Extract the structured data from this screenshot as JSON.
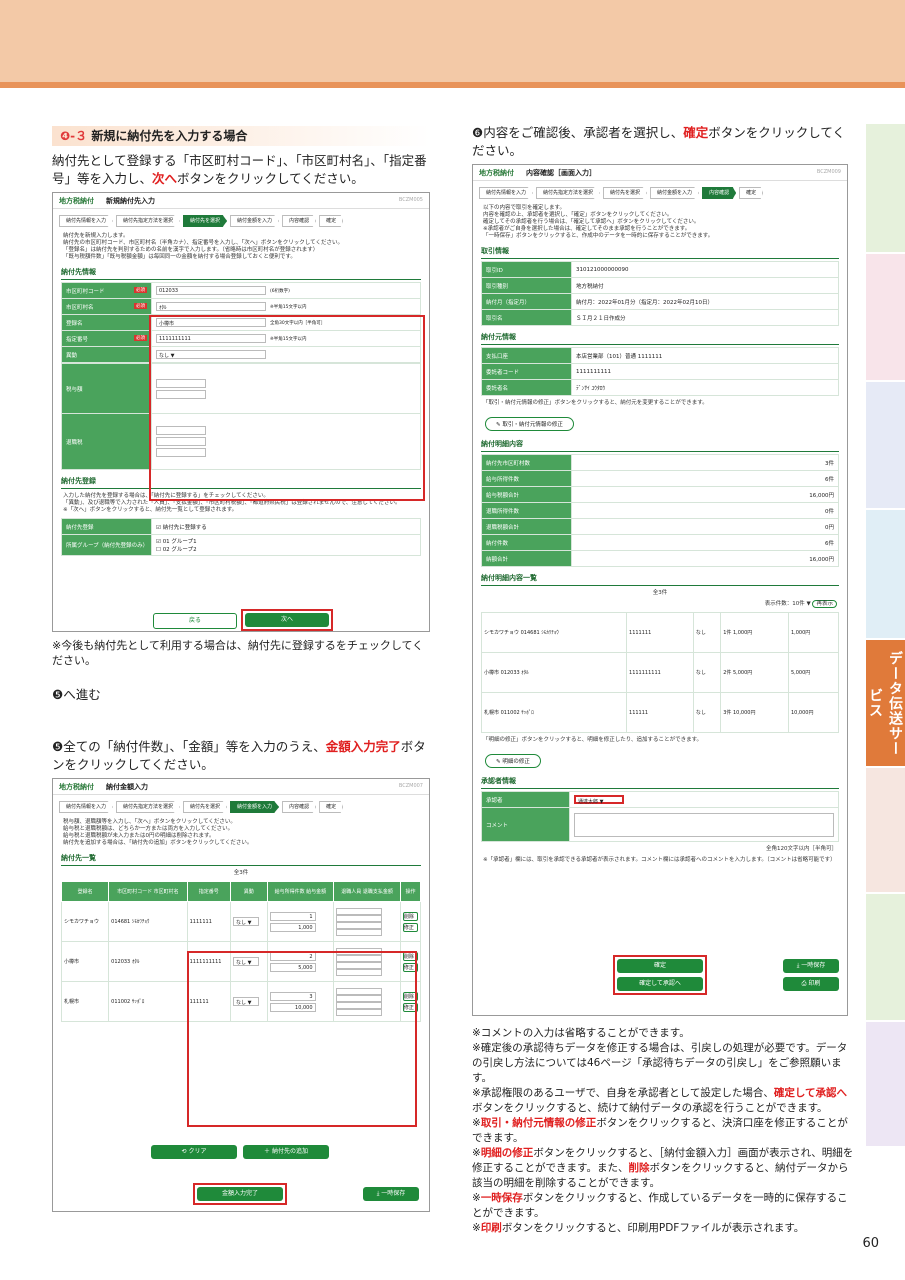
{
  "section4": {
    "num": "❹-３",
    "title": "新規に納付先を入力する場合",
    "para_a": "納付先として登録する「市区町村コード」、「市区町村名」、「指定番号」等を入力し、",
    "para_next": "次へ",
    "para_b": "ボタンをクリックしてください。",
    "footnote": "※今後も納付先として利用する場合は、納付先に登録するをチェックしてください。"
  },
  "goto5": "❺へ進む",
  "section5": {
    "text_a": "❺全ての「納付件数」、「金額」等を入力のうえ、",
    "text_red": "金額入力完了",
    "text_b": "ボタンをクリックしてください。"
  },
  "section6": {
    "text_a": "❻内容をご確認後、承認者を選択し、",
    "text_red": "確定",
    "text_b": "ボタンをクリックしてください。"
  },
  "shot1": {
    "app": "地方税納付",
    "title": "新規納付先入力",
    "code": "BCZM005",
    "steps": [
      "納付先情報を入力",
      "納付先指定方法を選択",
      "納付先を選択",
      "納付金額を入力",
      "内容確認",
      "確定"
    ],
    "active_step": 2,
    "intro": [
      "納付先を新規入力します。",
      "納付先の市区町村コード、市区町村名（半角カナ）、指定番号を入力し、「次へ」ボタンをクリックしてください。",
      "「登録名」は納付先を判別するための名前を漢字で入力します。（省略時は市区町村名が登録されます）",
      "「既与税額件数」「既与税額金額」は毎回同一の金額を納付する場合登録しておくと便利です。"
    ],
    "sec_title": "納付先情報",
    "rows": [
      {
        "label": "市区町村コード",
        "value": "012033",
        "hint": "(6桁数字)",
        "req": "必須"
      },
      {
        "label": "市区町村名",
        "value": "ｵﾀﾙ",
        "hint": "※半角15文字以内",
        "req": "必須"
      },
      {
        "label": "登録名",
        "value": "小樽市",
        "hint": "全角30文字以内［半角可］",
        "req": ""
      },
      {
        "label": "指定番号",
        "value": "1111111111",
        "hint": "※半角15文字以内",
        "req": "必須"
      },
      {
        "label": "異動",
        "value": "なし ▼",
        "hint": "",
        "req": ""
      }
    ],
    "reg_title": "納付先登録",
    "reg_note": [
      "入力した納付先を登録する場合は、「納付先に登録する」をチェックしてください。",
      "「異動」、及び退職等で入力された「人員」、「支払金額」、「市区町村税額」、「都道府県民税」は登録されませんので、注意してください。",
      "※「次へ」ボタンをクリックすると、納付先一覧として登録されます。"
    ],
    "reg_label": "納付先登録",
    "reg_check": "納付先に登録する",
    "group_label": "所属グループ（納付先登録のみ）",
    "groups": [
      "01 グループ1",
      "02 グループ2"
    ],
    "back": "戻る",
    "next": "次へ"
  },
  "shot2": {
    "app": "地方税納付",
    "title": "納付金額入力",
    "code": "BCZM007",
    "steps": [
      "納付先情報を入力",
      "納付先指定方法を選択",
      "納付先を選択",
      "納付金額を入力",
      "内容確認",
      "確定"
    ],
    "active_step": 3,
    "intro": [
      "税与額、退職額等を入力し、「次へ」ボタンをクリックしてください。",
      "給与税と退職税額は、どちらか一方または両方を入力してください。",
      "給与税と退職税額が未入力または0円の明細は削除されます。",
      "納付先を追加する場合は、「納付先の追加」ボタンをクリックしてください。"
    ],
    "sec_title": "納付先一覧",
    "count": "全3件",
    "cols": [
      "登録名",
      "市区町村コード 市区町村名",
      "指定番号",
      "異動",
      "給与所得件数 給与金額",
      "退職人員 退職支払金額",
      "操作"
    ],
    "rows": [
      {
        "name": "シモカワチョウ",
        "code": "014681 ｼﾓｶﾜﾁｮｳ",
        "num": "1111111",
        "move": "なし ▼",
        "cnt": "1",
        "amt": "1,000"
      },
      {
        "name": "小樽市",
        "code": "012033 ｵﾀﾙ",
        "num": "1111111111",
        "move": "なし ▼",
        "cnt": "2",
        "amt": "5,000"
      },
      {
        "name": "札幌市",
        "code": "011002 ｻｯﾎﾟﾛ",
        "num": "111111",
        "move": "なし ▼",
        "cnt": "3",
        "amt": "10,000"
      }
    ],
    "clear": "クリア",
    "add": "納付先の追加",
    "done": "金額入力完了",
    "save": "一時保存",
    "del": "削除",
    "edit": "修正"
  },
  "shot3": {
    "app": "地方税納付",
    "title": "内容確認［画面入力］",
    "code": "BCZM009",
    "steps": [
      "納付先情報を入力",
      "納付先指定方法を選択",
      "納付先を選択",
      "納付金額を入力",
      "内容確認",
      "確定"
    ],
    "active_step": 4,
    "intro": [
      "以下の内容で取引を確定します。",
      "内容を確認の上、承認者を選択し、「確定」ボタンをクリックしてください。",
      "確定してその承認者を行う場合は、「確定して承認へ」ボタンをクリックしてください。",
      "※承認者がご自身を選択した場合は、確定してそのまま承認を行うことができます。",
      "「一時保存」ボタンをクリックすると、作成中のデータを一時的に保存することができます。"
    ],
    "tx_title": "取引情報",
    "tx": [
      [
        "取引ID",
        "310121000000090"
      ],
      [
        "取引種別",
        "地方税納付"
      ],
      [
        "納付月（指定月）",
        "納付月：2022年01月分（指定月：2022年02月10日）"
      ],
      [
        "取引名",
        "ＳＩ月２１日作成分"
      ]
    ],
    "acc_title": "納付元情報",
    "acc": [
      [
        "支払口座",
        "本店営業部（101）普通 1111111"
      ],
      [
        "委託者コード",
        "1111111111"
      ],
      [
        "委託者名",
        "ﾃﾞﾝｻｲ ﾕｳﾀﾛｳ"
      ]
    ],
    "acc_note": "「取引・納付元情報の修正」ボタンをクリックすると、納付元を変更することができます。",
    "acc_btn": "取引・納付元情報の修正",
    "sum_title": "納付明細内容",
    "sum": [
      [
        "納付先市区町村数",
        "3件"
      ],
      [
        "給与所得件数",
        "6件"
      ],
      [
        "給与税額合計",
        "16,000円"
      ],
      [
        "退職所得件数",
        "0件"
      ],
      [
        "退職税額合計",
        "0円"
      ],
      [
        "納付件数",
        "6件"
      ],
      [
        "納額合計",
        "16,000円"
      ]
    ],
    "list_title": "納付明細内容一覧",
    "list_count": "全3件",
    "per_page": "表示件数：10件 ▼",
    "redisp": "再表示",
    "list": [
      [
        "シモカワチョウ 014681 ｼﾓｶﾜﾁｮｳ",
        "1111111",
        "なし",
        "1件 1,000円",
        "1,000円"
      ],
      [
        "小樽市 012033 ｵﾀﾙ",
        "1111111111",
        "なし",
        "2件 5,000円",
        "5,000円"
      ],
      [
        "札幌市 011002 ｻｯﾎﾟﾛ",
        "111111",
        "なし",
        "3件 10,000円",
        "10,000円"
      ]
    ],
    "list_note": "「明細の修正」ボタンをクリックすると、明細を修正したり、追加することができます。",
    "list_btn": "明細の修正",
    "appr_title": "承認者情報",
    "appr_label": "承認者",
    "appr_value": "通達太郎",
    "comment_label": "コメント",
    "comment_hint": "全角120文字以内［半角可］",
    "appr_note": "※「承認者」欄には、取引を承認できる承認者が表示されます。コメント欄には承認者へのコメントを入力します。（コメントは省略可能です）",
    "confirm": "確定",
    "confirm_approve": "確定して承認へ",
    "save": "一時保存",
    "print": "印刷"
  },
  "notes": [
    "※コメントの入力は省略することができます。",
    "※確定後の承認待ちデータを修正する場合は、引戻しの処理が必要です。データの引戻し方法については46ページ「承認待ちデータの引戻し」をご参照願います。",
    "※承認権限のあるユーザで、自身を承認者として設定した場合、",
    "確定して承認へ",
    "ボタンをクリックすると、続けて納付データの承認を行うことができます。",
    "※",
    "取引・納付元情報の修正",
    "ボタンをクリックすると、決済口座を修正することができます。",
    "※",
    "明細の修正",
    "ボタンをクリックすると、［納付金額入力］画面が表示され、明細を修正することができます。また、",
    "削除",
    "ボタンをクリックすると、納付データから該当の明細を削除することができます。",
    "※",
    "一時保存",
    "ボタンをクリックすると、作成しているデータを一時的に保存することができます。",
    "※",
    "印刷",
    "ボタンをクリックすると、印刷用PDFファイルが表示されます。"
  ],
  "side_label": "データ伝送サービス",
  "page_num": "60",
  "colors": {
    "accent": "#1f8a3a",
    "red": "#d62828",
    "tab": "#e07a3a"
  }
}
